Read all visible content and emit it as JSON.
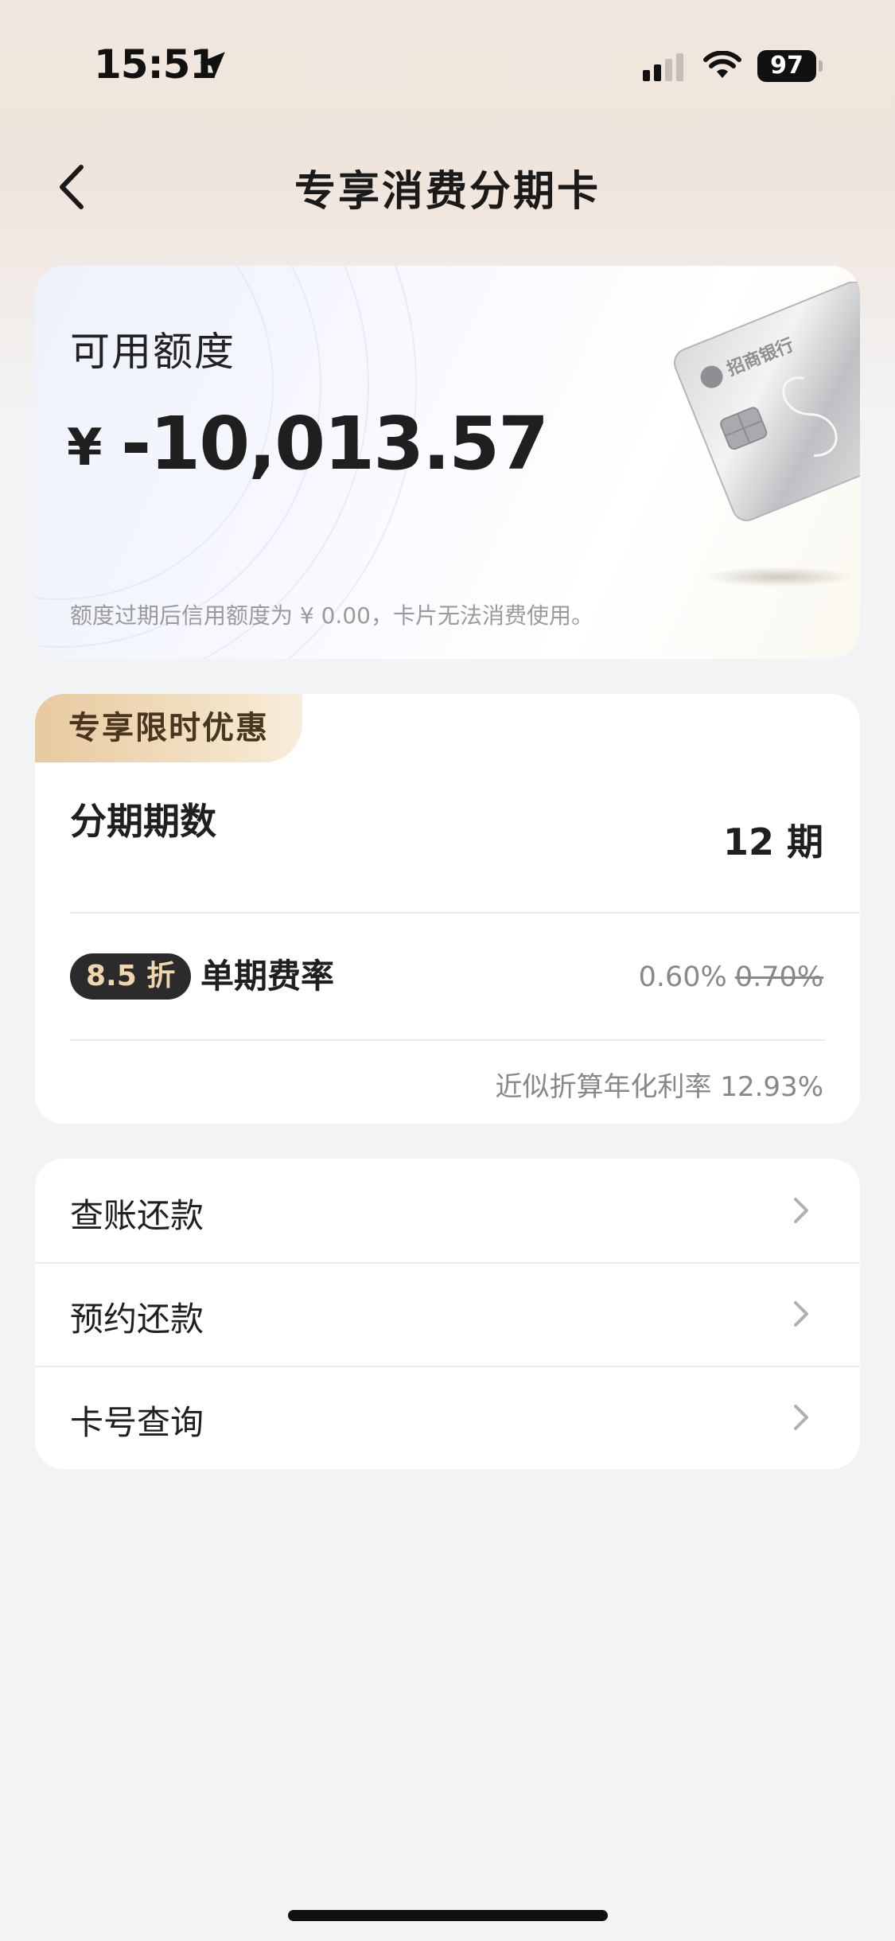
{
  "status_bar": {
    "time": "15:51",
    "battery": "97",
    "icons": [
      "location-arrow-icon",
      "cellular-signal-icon",
      "wifi-icon",
      "battery-icon"
    ]
  },
  "header": {
    "title": "专享消费分期卡",
    "back_icon": "chevron-left-icon"
  },
  "credit": {
    "label": "可用额度",
    "currency": "¥",
    "amount": "-10,013.57",
    "note": "额度过期后信用额度为 ¥ 0.00，卡片无法消费使用。",
    "card_logo_text": "招商银行"
  },
  "promo": {
    "tag": "专享限时优惠",
    "period_label": "分期期数",
    "period_value": "12 期",
    "discount_badge": "8.5 折",
    "rate_label": "单期费率",
    "rate_current": "0.60%",
    "rate_original": "0.70%",
    "annual_rate": "近似折算年化利率 12.93%"
  },
  "menu": {
    "items": [
      {
        "label": "查账还款"
      },
      {
        "label": "预约还款"
      },
      {
        "label": "卡号查询"
      }
    ]
  },
  "colors": {
    "header_bg": "#f1e6dd",
    "page_bg": "#f2f3f5",
    "promo_tag": "#e7c99e",
    "badge_bg": "#2b2b2b",
    "badge_text": "#f0d6ac"
  }
}
